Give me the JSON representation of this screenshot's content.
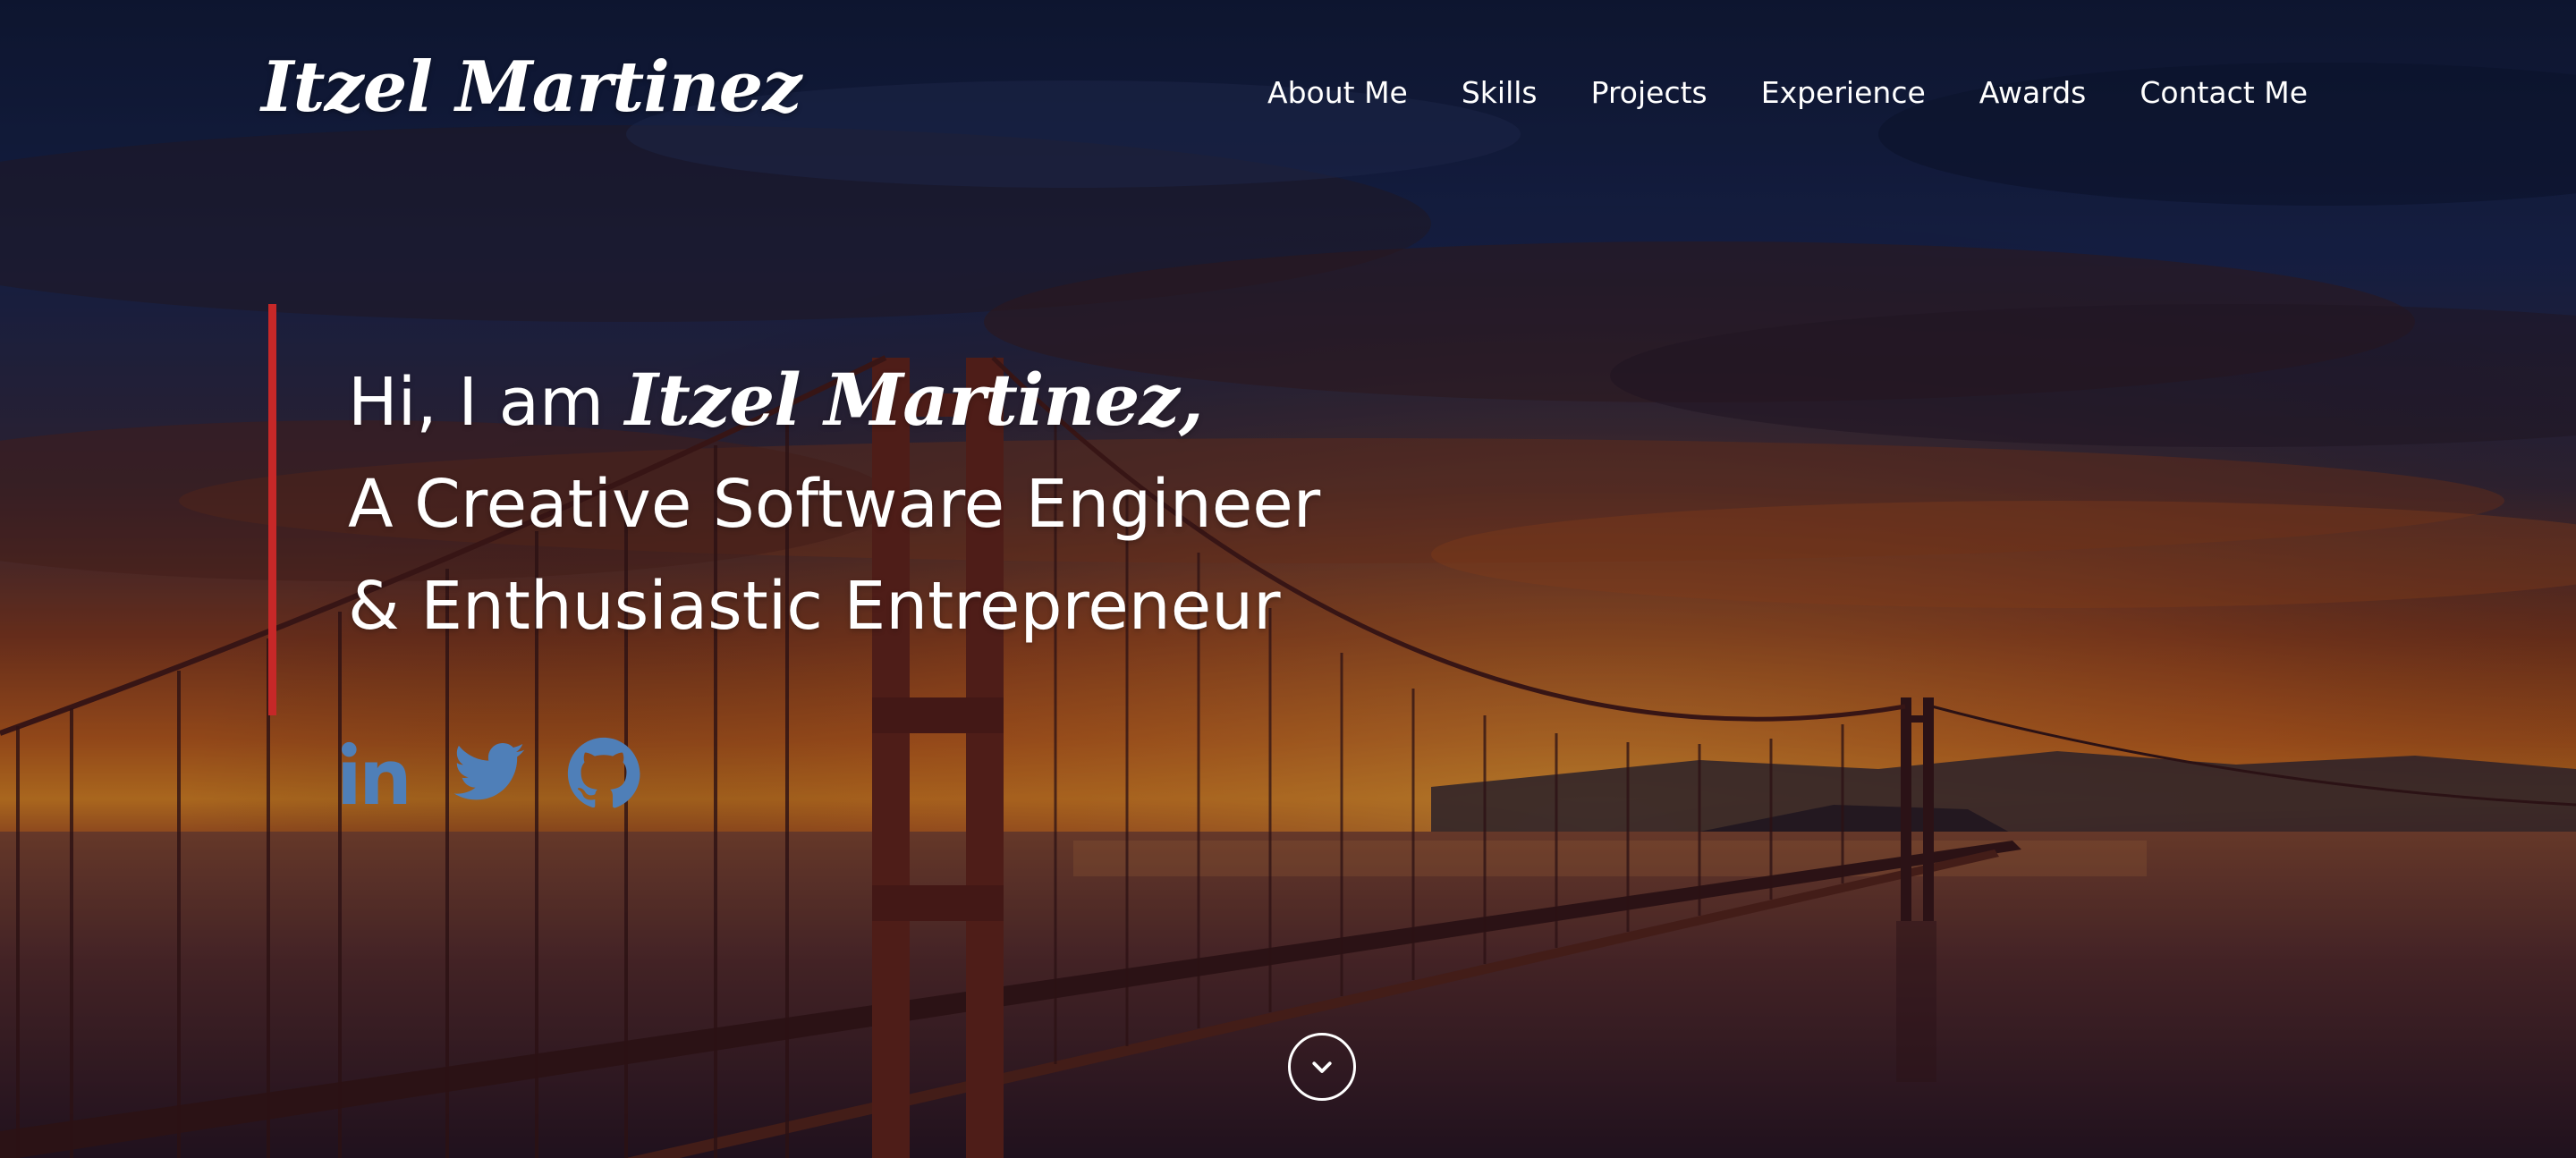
{
  "header": {
    "brand": "Itzel Martinez",
    "nav": [
      {
        "label": "About Me"
      },
      {
        "label": "Skills"
      },
      {
        "label": "Projects"
      },
      {
        "label": "Experience"
      },
      {
        "label": "Awards"
      },
      {
        "label": "Contact Me"
      }
    ]
  },
  "intro": {
    "greeting": "Hi, I am ",
    "name": "Itzel Martinez,",
    "line2": "A Creative Software Engineer",
    "line3": "& Enthusiastic Entrepreneur",
    "accent_color": "#c62828"
  },
  "social": [
    {
      "icon": "linkedin-icon"
    },
    {
      "icon": "twitter-icon"
    },
    {
      "icon": "github-icon"
    }
  ],
  "social_color": "#4f7fb8",
  "scroll": {
    "icon": "chevron-down-icon"
  },
  "background": {
    "subject": "bridge-at-sunset-photo"
  }
}
